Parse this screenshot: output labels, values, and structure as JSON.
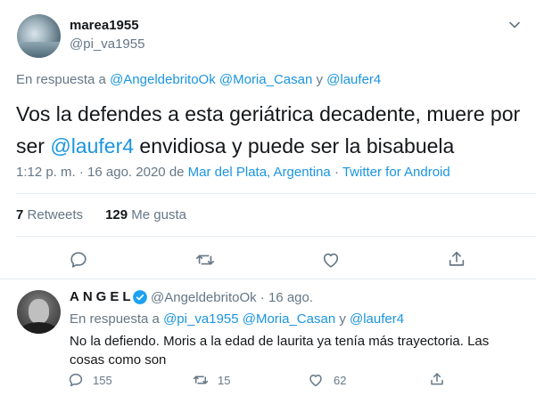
{
  "tweet": {
    "author_name": "marea1955",
    "author_handle": "@pi_va1955",
    "reply_prefix": "En respuesta a",
    "reply_mentions": [
      "@AngeldebritoOk",
      "@Moria_Casan",
      "@laufer4"
    ],
    "reply_joiner": "y",
    "text_part1": "Vos la defendes a esta geriátrica decadente, muere por ser",
    "text_mention": "@laufer4",
    "text_part2": "envidiosa y puede ser la bisabuela",
    "time": "1:12 p. m.",
    "date": "16 ago. 2020",
    "de": "de",
    "location": "Mar del Plata, Argentina",
    "source": "Twitter for Android",
    "retweets_count": "7",
    "retweets_label": "Retweets",
    "likes_count": "129",
    "likes_label": "Me gusta"
  },
  "reply": {
    "author_name": "ANGEL",
    "author_handle": "@AngeldebritoOk",
    "date": "16 ago.",
    "reply_prefix": "En respuesta a",
    "reply_mentions": [
      "@pi_va1955",
      "@Moria_Casan",
      "@laufer4"
    ],
    "reply_joiner": "y",
    "text": "No la defiendo. Moris a la edad de laurita ya tenía más trayectoria. Las cosas como son",
    "reply_count": "155",
    "retweet_count": "15",
    "like_count": "62"
  },
  "colors": {
    "accent": "#1b95e0",
    "secondary_text": "#657786",
    "primary_text": "#14171a",
    "divider": "#e6ecf0"
  },
  "icons": {
    "menu": "chevron-down-icon",
    "reply": "reply-icon",
    "retweet": "retweet-icon",
    "like": "heart-icon",
    "share": "share-icon",
    "verified": "verified-badge-icon"
  }
}
